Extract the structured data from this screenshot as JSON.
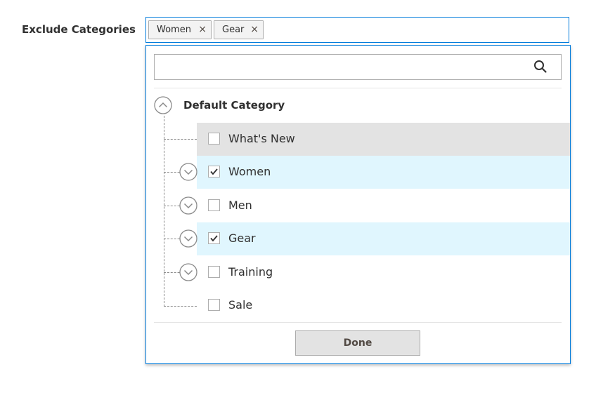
{
  "field": {
    "label": "Exclude Categories",
    "chips": [
      {
        "label": "Women",
        "remove": "×"
      },
      {
        "label": "Gear",
        "remove": "×"
      }
    ]
  },
  "dropdown": {
    "search": {
      "placeholder": "",
      "value": "",
      "icon": "search-icon"
    },
    "root": {
      "label": "Default Category",
      "state": "expanded",
      "icon": "chevron-up-icon"
    },
    "options": [
      {
        "label": "What's New",
        "checked": false,
        "has_children": false,
        "state": "hover"
      },
      {
        "label": "Women",
        "checked": true,
        "has_children": true,
        "state": "selected"
      },
      {
        "label": "Men",
        "checked": false,
        "has_children": true,
        "state": "none"
      },
      {
        "label": "Gear",
        "checked": true,
        "has_children": true,
        "state": "selected"
      },
      {
        "label": "Training",
        "checked": false,
        "has_children": true,
        "state": "none"
      },
      {
        "label": "Sale",
        "checked": false,
        "has_children": false,
        "state": "none"
      }
    ],
    "done_label": "Done"
  },
  "colors": {
    "focus_border": "#007bdb",
    "selected_row": "#e0f6fe",
    "hover_row": "#e3e3e3",
    "text": "#303030",
    "icon": "#8a8a8a"
  }
}
